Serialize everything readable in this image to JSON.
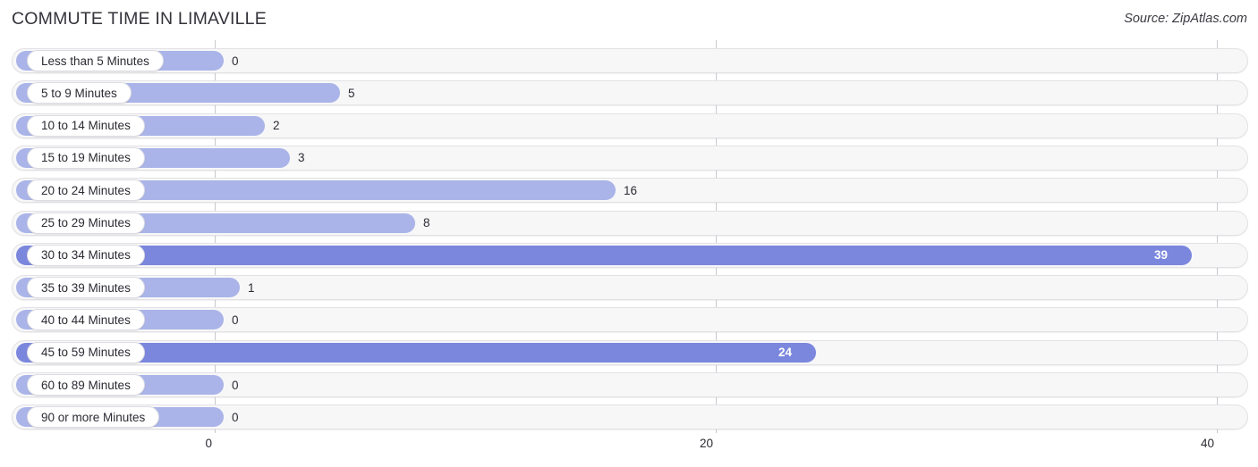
{
  "header": {
    "title": "COMMUTE TIME IN LIMAVILLE",
    "source": "Source: ZipAtlas.com"
  },
  "colors": {
    "bar": "#aab4e8",
    "bar_highlight": "#7b87dd",
    "track": "#f7f7f8",
    "gridline": "#c9c9cf",
    "text": "#2b2b33"
  },
  "chart_data": {
    "type": "bar",
    "orientation": "horizontal",
    "title": "COMMUTE TIME IN LIMAVILLE",
    "xlabel": "",
    "ylabel": "",
    "xlim": [
      0,
      40
    ],
    "xticks": [
      0,
      20,
      40
    ],
    "xtick_labels": [
      "0",
      "20",
      "40"
    ],
    "grid": true,
    "legend": false,
    "categories": [
      "Less than 5 Minutes",
      "5 to 9 Minutes",
      "10 to 14 Minutes",
      "15 to 19 Minutes",
      "20 to 24 Minutes",
      "25 to 29 Minutes",
      "30 to 34 Minutes",
      "35 to 39 Minutes",
      "40 to 44 Minutes",
      "45 to 59 Minutes",
      "60 to 89 Minutes",
      "90 or more Minutes"
    ],
    "values": [
      0,
      5,
      2,
      3,
      16,
      8,
      39,
      1,
      0,
      24,
      0,
      0
    ],
    "value_labels": [
      "0",
      "5",
      "2",
      "3",
      "16",
      "8",
      "39",
      "1",
      "0",
      "24",
      "0",
      "0"
    ],
    "highlighted": [
      false,
      false,
      false,
      false,
      false,
      false,
      true,
      false,
      false,
      true,
      false,
      false
    ]
  }
}
